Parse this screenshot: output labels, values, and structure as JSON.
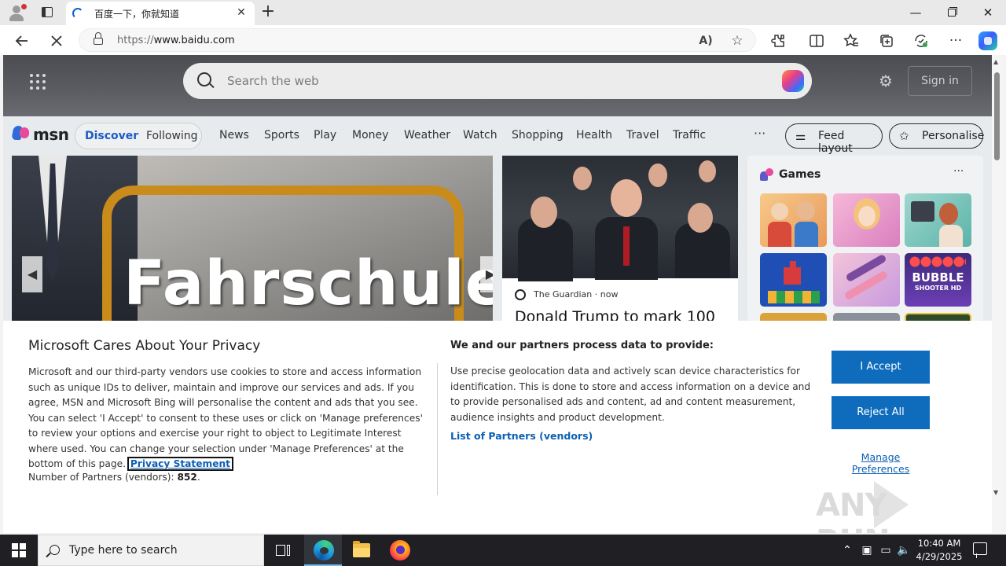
{
  "browser": {
    "tab_title": "百度一下，你就知道",
    "tab_close": "✕",
    "new_tab": "+",
    "url_proto": "https://",
    "url_rest": "www.baidu.com",
    "window": {
      "minimize": "—",
      "close": "✕"
    },
    "toolbar_icons": [
      "extensions-icon",
      "split-screen-icon",
      "favorites-icon",
      "collections-icon",
      "performance-icon",
      "more-icon",
      "copilot-icon"
    ]
  },
  "msn": {
    "search_placeholder": "Search the web",
    "sign_in": "Sign in",
    "logo_text": "msn",
    "pill": {
      "discover": "Discover",
      "following": "Following"
    },
    "nav": [
      "News",
      "Sports",
      "Play",
      "Money",
      "Weather",
      "Watch",
      "Shopping",
      "Health",
      "Travel",
      "Traffic"
    ],
    "nav_more": "···",
    "feed_layout": "Feed layout",
    "personalise": "Personalise",
    "hero_text": "Fahrschule",
    "news_card": {
      "source": "The Guardian",
      "separator": "·",
      "time": "now",
      "title": "Donald Trump to mark 100"
    },
    "games": {
      "title": "Games",
      "more": "···",
      "bubble_title": "BUBBLE",
      "bubble_sub": "SHOOTER HD"
    }
  },
  "consent": {
    "title": "Microsoft Cares About Your Privacy",
    "body": "Microsoft and our third-party vendors use cookies to store and access information such as unique IDs to deliver, maintain and improve our services and ads. If you agree, MSN and Microsoft Bing will personalise the content and ads that you see. You can select 'I Accept' to consent to these uses or click on 'Manage preferences' to review your options and exercise your right to object to Legitimate Interest where used.  You can change your selection under 'Manage Preferences' at the bottom of this page.",
    "privacy_link": "Privacy Statement",
    "partners_label": "Number of Partners (vendors):",
    "partners_count": "852",
    "right_title": "We and our partners process data to provide:",
    "right_body": "Use precise geolocation data and actively scan device characteristics for identification. This is done to store and access information on a device and to provide personalised ads and content, ad and content measurement, audience insights and product development.",
    "vendors_link": "List of Partners (vendors)",
    "accept": "I Accept",
    "reject": "Reject All",
    "manage": "Manage Preferences"
  },
  "watermark": "ANY RUN",
  "taskbar": {
    "search_placeholder": "Type here to search",
    "time": "10:40 AM",
    "date": "4/29/2025"
  }
}
